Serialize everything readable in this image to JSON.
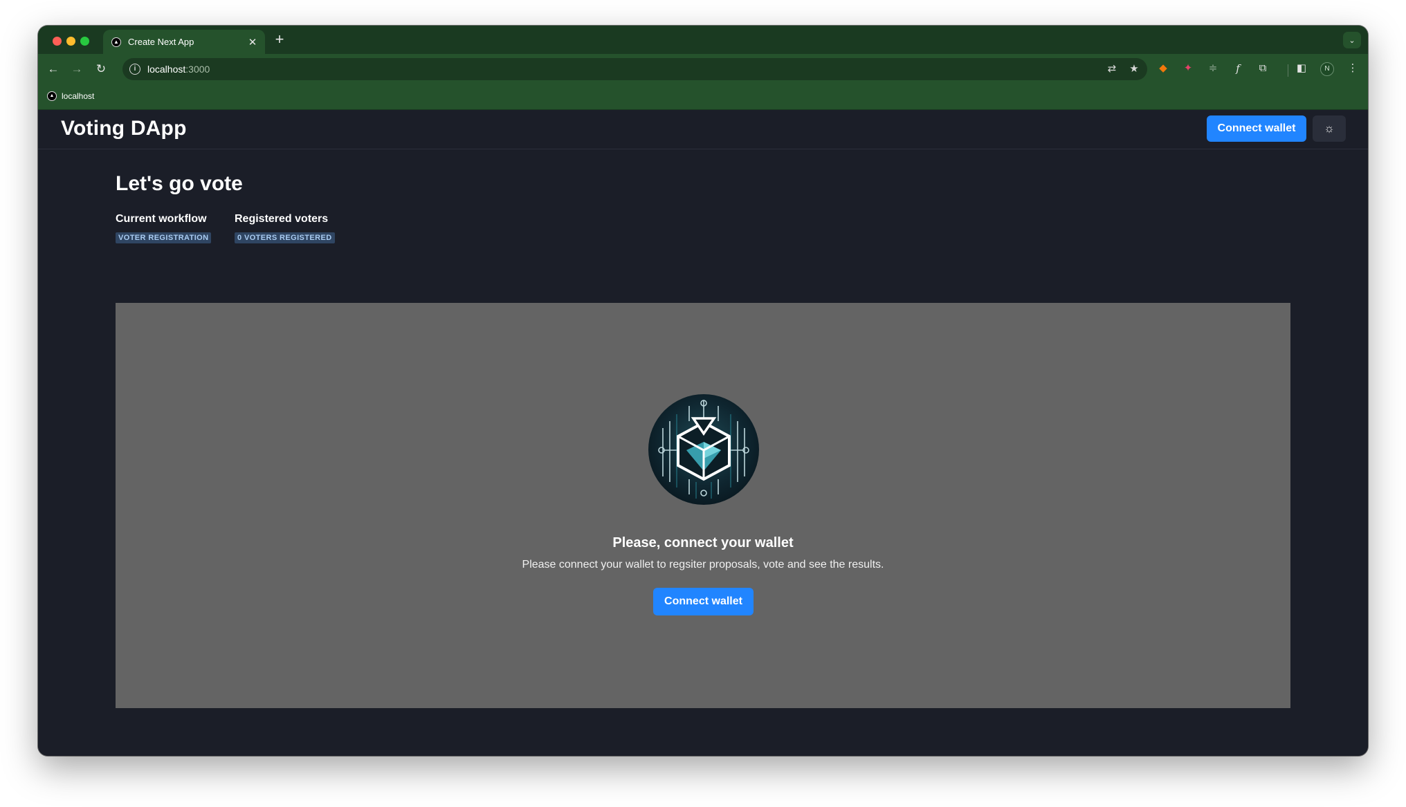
{
  "browser": {
    "tab_title": "Create Next App",
    "tab_close": "✕",
    "new_tab": "+",
    "tab_search": "⌄",
    "back": "←",
    "forward": "→",
    "reload": "↻",
    "info_icon": "i",
    "url_host": "localhost",
    "url_port": ":3000",
    "translate_icon": "⇄",
    "bookmark_star": "★",
    "bookmark_label": "localhost",
    "profile_initial": "N",
    "menu": "⋮"
  },
  "header": {
    "app_title": "Voting DApp",
    "connect_label": "Connect wallet",
    "theme_icon": "☼"
  },
  "main": {
    "title": "Let's go vote",
    "stats": [
      {
        "label": "Current workflow",
        "badge": "VOTER REGISTRATION"
      },
      {
        "label": "Registered voters",
        "badge": "0 VOTERS REGISTERED"
      }
    ],
    "panel": {
      "heading": "Please, connect your wallet",
      "description": "Please connect your wallet to regsiter proposals, vote and see the results.",
      "connect_label": "Connect wallet"
    }
  },
  "colors": {
    "browser_frame": "#1a3a21",
    "browser_toolbar": "#25522c",
    "page_bg": "#1b1e28",
    "panel_bg": "#646464",
    "accent": "#2185ff",
    "badge_bg": "#2f4562",
    "badge_text": "#a9cbf1"
  }
}
